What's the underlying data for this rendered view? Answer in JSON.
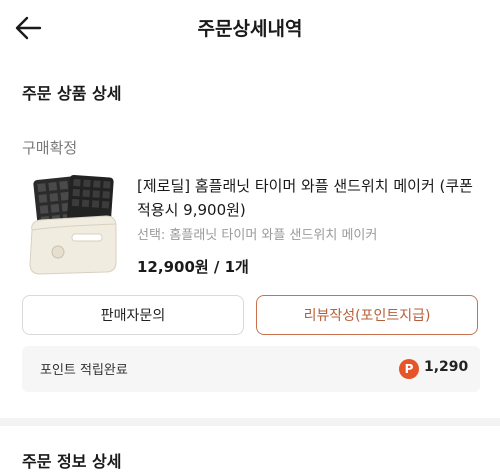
{
  "header": {
    "title": "주문상세내역",
    "back_icon": "arrow-left-icon"
  },
  "order_products": {
    "section_title": "주문 상품 상세",
    "status": "구매확정",
    "product": {
      "name": "[제로딜] 홈플래닛 타이머 와플 샌드위치 메이커 (쿠폰적용시 9,900원)",
      "option": "선택: 홈플래닛 타이머 와플 샌드위치 메이커",
      "price_qty": "12,900원 / 1개"
    },
    "buttons": {
      "inquiry": "판매자문의",
      "review": "리뷰작성(포인트지급)"
    },
    "points": {
      "label": "포인트 적립완료",
      "icon_letter": "P",
      "value": "1,290",
      "icon_color": "#e4562a"
    }
  },
  "order_info": {
    "section_title": "주문 정보 상세"
  },
  "colors": {
    "accent": "#b85f38",
    "review_border": "#c8734e"
  }
}
